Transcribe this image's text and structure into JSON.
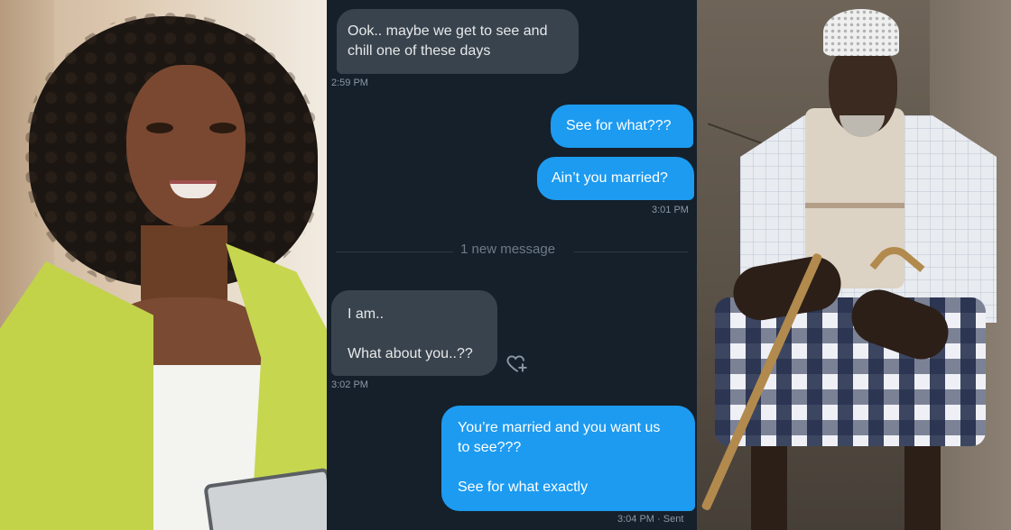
{
  "chat": {
    "messages": [
      {
        "lines": [
          "Ook.. maybe we get to see and",
          "chill one of these days"
        ]
      },
      {
        "lines": [
          "See for what???"
        ]
      },
      {
        "lines": [
          "Ain’t you married?"
        ]
      },
      {
        "lines": [
          "I am..",
          "",
          "What about you..??"
        ]
      },
      {
        "lines": [
          "You’re married and you want us",
          "to see???",
          "",
          "See for what exactly"
        ]
      }
    ],
    "times": [
      "2:59 PM",
      "3:01 PM",
      "3:02 PM",
      "3:04 PM · Sent"
    ],
    "divider": "1 new message"
  },
  "colors": {
    "chat_bg": "#15202b",
    "incoming": "#39434d",
    "outgoing": "#1d9bf0",
    "muted": "#8b98a5"
  },
  "icons": {
    "react": "heart-plus-icon"
  }
}
